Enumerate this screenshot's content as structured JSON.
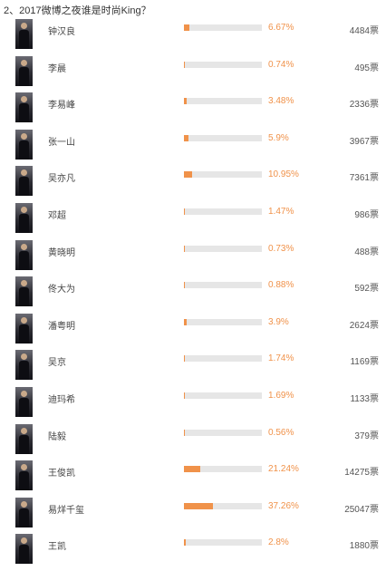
{
  "question": "2、2017微博之夜谁是时尚King？",
  "colors": {
    "bar_fill": "#f0924a",
    "bar_track": "#e6e6e6",
    "percent_text": "#f0924a"
  },
  "options": [
    {
      "name": "钟汉良",
      "percent_label": "6.67%",
      "percent": 6.67,
      "votes": "4484票"
    },
    {
      "name": "李晨",
      "percent_label": "0.74%",
      "percent": 0.74,
      "votes": "495票"
    },
    {
      "name": "李易峰",
      "percent_label": "3.48%",
      "percent": 3.48,
      "votes": "2336票"
    },
    {
      "name": "张一山",
      "percent_label": "5.9%",
      "percent": 5.9,
      "votes": "3967票"
    },
    {
      "name": "吴亦凡",
      "percent_label": "10.95%",
      "percent": 10.95,
      "votes": "7361票"
    },
    {
      "name": "邓超",
      "percent_label": "1.47%",
      "percent": 1.47,
      "votes": "986票"
    },
    {
      "name": "黄晓明",
      "percent_label": "0.73%",
      "percent": 0.73,
      "votes": "488票"
    },
    {
      "name": "佟大为",
      "percent_label": "0.88%",
      "percent": 0.88,
      "votes": "592票"
    },
    {
      "name": "潘粤明",
      "percent_label": "3.9%",
      "percent": 3.9,
      "votes": "2624票"
    },
    {
      "name": "吴京",
      "percent_label": "1.74%",
      "percent": 1.74,
      "votes": "1169票"
    },
    {
      "name": "迪玛希",
      "percent_label": "1.69%",
      "percent": 1.69,
      "votes": "1133票"
    },
    {
      "name": "陆毅",
      "percent_label": "0.56%",
      "percent": 0.56,
      "votes": "379票"
    },
    {
      "name": "王俊凯",
      "percent_label": "21.24%",
      "percent": 21.24,
      "votes": "14275票"
    },
    {
      "name": "易烊千玺",
      "percent_label": "37.26%",
      "percent": 37.26,
      "votes": "25047票"
    },
    {
      "name": "王凯",
      "percent_label": "2.8%",
      "percent": 2.8,
      "votes": "1880票"
    }
  ]
}
